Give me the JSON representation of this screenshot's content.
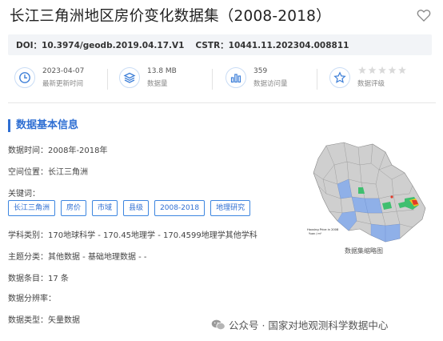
{
  "header": {
    "title": "长江三角洲地区房价变化数据集（2008-2018）"
  },
  "doi_bar": {
    "doi": "DOI：10.3974/geodb.2019.04.17.V1",
    "cstr": "CSTR：10441.11.202304.008811"
  },
  "stats": [
    {
      "value": "2023-04-07",
      "label": "最新更新时间",
      "icon": "clock-icon"
    },
    {
      "value": "13.8 MB",
      "label": "数据量",
      "icon": "layers-icon"
    },
    {
      "value": "359",
      "label": "数据访问量",
      "icon": "bar-chart-icon"
    },
    {
      "value": "",
      "label": "数据评级",
      "icon": "star-icon",
      "rating": 0,
      "rating_max": 5
    }
  ],
  "section": {
    "title": "数据基本信息"
  },
  "info": {
    "time": "数据时间：2008年-2018年",
    "location": "空间位置：长江三角洲",
    "keywords_label": "关键词：",
    "keywords": [
      "长江三角洲",
      "房价",
      "市域",
      "县级",
      "2008-2018",
      "地理研究"
    ],
    "subject": "学科类别：170地球科学 - 170.45地理学 - 170.4599地理学其他学科",
    "theme": "主题分类：其他数据 - 基础地理数据 - -",
    "entries": "数据条目：17 条",
    "resolution": "数据分辨率：",
    "type": "数据类型：矢量数据"
  },
  "map": {
    "caption": "数据集缩略图",
    "inner_text_line1": "Housing Price in 2008",
    "inner_text_line2": "Yuan / m²"
  },
  "footer": {
    "text": "公众号 · 国家对地观测科学数据中心"
  },
  "colors": {
    "accent": "#2f6fd3",
    "map_gray": "#c8c8c8",
    "map_blue": "#8fb0e8",
    "map_green": "#3fbf6f",
    "map_red": "#e03a2a"
  }
}
